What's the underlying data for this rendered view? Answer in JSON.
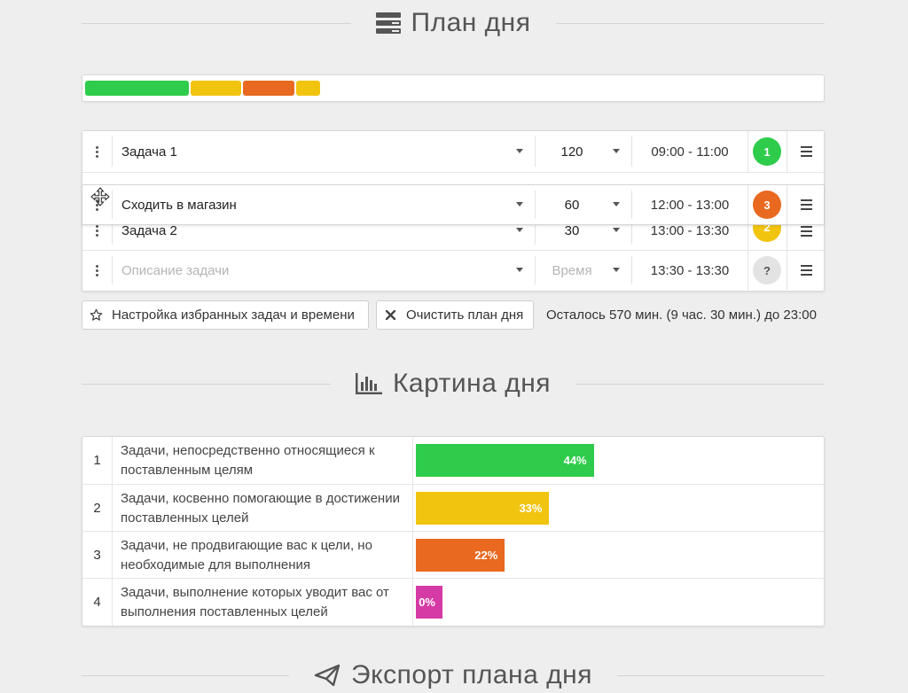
{
  "plan": {
    "title": "План дня",
    "icon": "server-stack-icon",
    "progress": [
      {
        "color": "#2ecc4a"
      },
      {
        "color": "#f1c40f"
      },
      {
        "color": "#e8691f"
      },
      {
        "color": "#f1c40f"
      }
    ],
    "tasks": [
      {
        "description": "Задача 1",
        "duration": "120",
        "time": "09:00 - 11:00",
        "badge": "1",
        "badge_color": "#2ecc4a"
      },
      {
        "description": "Сходить в магазин",
        "duration": "60",
        "time": "12:00 - 13:00",
        "badge": "3",
        "badge_color": "#e8691f"
      },
      {
        "description": "Задача 2",
        "duration": "30",
        "time": "13:00 - 13:30",
        "badge": "2",
        "badge_color": "#f1c40f"
      }
    ],
    "new_task": {
      "description_placeholder": "Описание задачи",
      "duration_placeholder": "Время",
      "time": "13:30 - 13:30",
      "badge": "?",
      "badge_color": "#e3e3e3"
    },
    "favorites_button": "Настройка избранных задач и времени",
    "clear_button": "Очистить план дня",
    "remaining": "Осталось 570 мин. (9 час. 30 мин.) до 23:00"
  },
  "picture": {
    "title": "Картина дня",
    "icon": "bar-chart-icon",
    "rows": [
      {
        "num": "1",
        "text": "Задачи, непосредственно относящиеся к поставленным целям",
        "percent_label": "44%",
        "percent": 44,
        "color": "#2ecc4a"
      },
      {
        "num": "2",
        "text": "Задачи, косвенно помогающие в достижении поставленных целей",
        "percent_label": "33%",
        "percent": 33,
        "color": "#f1c40f"
      },
      {
        "num": "3",
        "text": "Задачи, не продвигающие вас к цели, но необходимые для выполнения",
        "percent_label": "22%",
        "percent": 22,
        "color": "#e8691f"
      },
      {
        "num": "4",
        "text": "Задачи, выполнение которых уводит вас от выполнения поставленных целей",
        "percent_label": "0%",
        "percent": 0,
        "color": "#d63aa5"
      }
    ]
  },
  "export": {
    "title": "Экспорт плана дня",
    "icon": "paper-plane-icon"
  }
}
